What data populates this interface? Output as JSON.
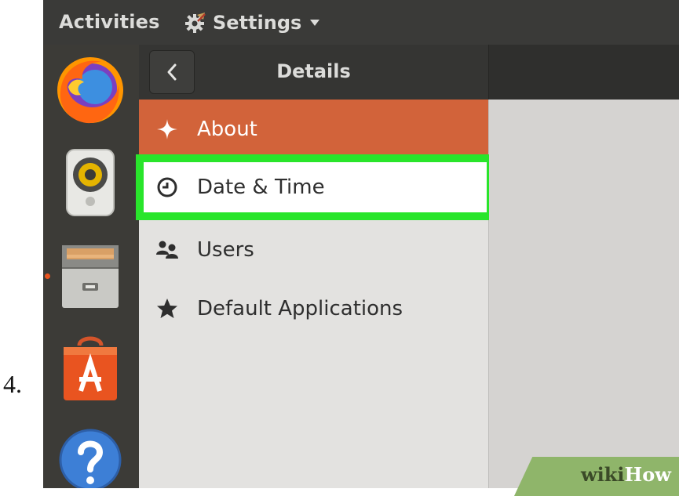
{
  "step_number": "4.",
  "top_bar": {
    "activities_label": "Activities",
    "app_menu_label": "Settings",
    "app_menu_icon": "settings-gear-icon"
  },
  "dock": {
    "items": [
      {
        "name": "firefox",
        "icon": "firefox-icon"
      },
      {
        "name": "rhythmbox",
        "icon": "speaker-icon"
      },
      {
        "name": "files",
        "icon": "file-cabinet-icon",
        "running": true
      },
      {
        "name": "software",
        "icon": "software-bag-icon"
      },
      {
        "name": "help",
        "icon": "help-icon"
      }
    ]
  },
  "header": {
    "title": "Details",
    "back_icon": "chevron-left-icon"
  },
  "sidebar": {
    "items": [
      {
        "label": "About",
        "icon": "sparkle-icon",
        "selected": true
      },
      {
        "label": "Date & Time",
        "icon": "clock-icon",
        "highlighted": true
      },
      {
        "label": "Users",
        "icon": "users-icon"
      },
      {
        "label": "Default Applications",
        "icon": "star-icon"
      }
    ]
  },
  "watermark": {
    "part1": "wiki",
    "part2": "How"
  },
  "colors": {
    "accent": "#d2633a",
    "highlight": "#29e52b",
    "topbar": "#3a3a38",
    "dock": "#3c3b37"
  }
}
